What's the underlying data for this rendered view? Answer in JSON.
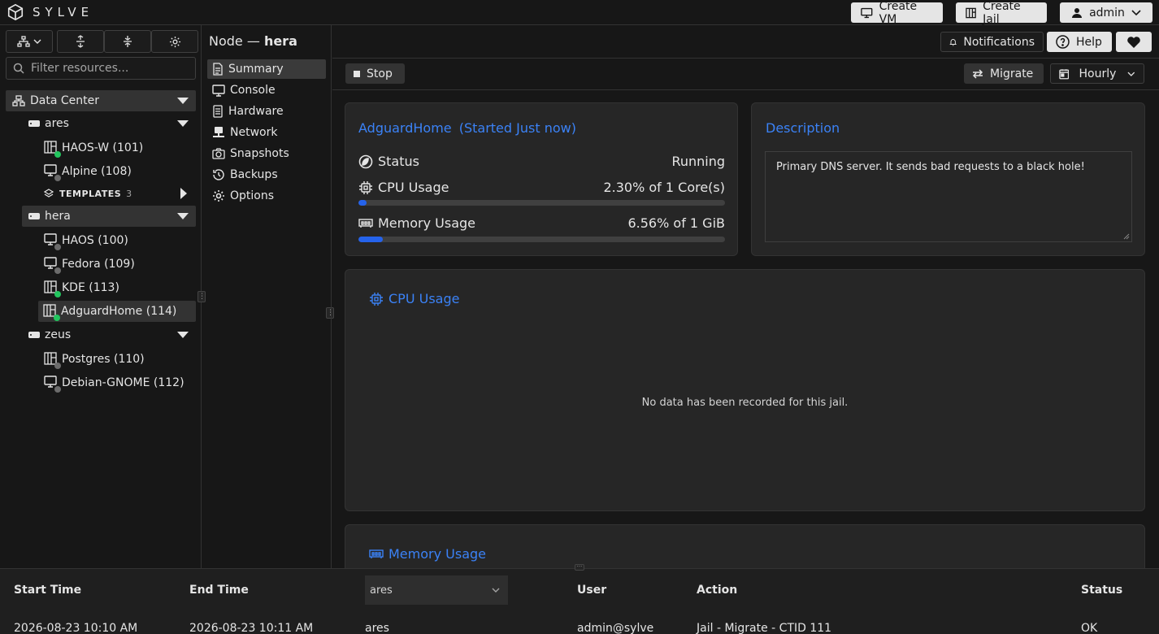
{
  "app": {
    "name": "SYLVE"
  },
  "topbar": {
    "create_vm": "Create VM",
    "create_jail": "Create Jail",
    "user": "admin"
  },
  "sidebar": {
    "filter_placeholder": "Filter resources...",
    "datacenter": "Data Center",
    "nodes": [
      {
        "name": "ares",
        "items": [
          {
            "label": "HAOS-W (101)",
            "type": "jail",
            "running": true
          },
          {
            "label": "Alpine (108)",
            "type": "vm",
            "running": false
          }
        ],
        "templates_label": "TEMPLATES",
        "templates_count": "3"
      },
      {
        "name": "hera",
        "items": [
          {
            "label": "HAOS (100)",
            "type": "vm",
            "running": false
          },
          {
            "label": "Fedora (109)",
            "type": "vm",
            "running": false
          },
          {
            "label": "KDE (113)",
            "type": "jail",
            "running": true
          },
          {
            "label": "AdguardHome (114)",
            "type": "jail",
            "running": true
          }
        ]
      },
      {
        "name": "zeus",
        "items": [
          {
            "label": "Postgres (110)",
            "type": "jail",
            "running": false
          },
          {
            "label": "Debian-GNOME (112)",
            "type": "vm",
            "running": false
          }
        ]
      }
    ]
  },
  "header": {
    "node_prefix": "Node —",
    "node_name": "hera",
    "notifications": "Notifications",
    "help": "Help"
  },
  "nav": {
    "summary": "Summary",
    "console": "Console",
    "hardware": "Hardware",
    "network": "Network",
    "snapshots": "Snapshots",
    "backups": "Backups",
    "options": "Options"
  },
  "actions": {
    "stop": "Stop",
    "migrate": "Migrate",
    "interval": "Hourly"
  },
  "summary": {
    "name": "AdguardHome",
    "started": "(Started Just now)",
    "status_label": "Status",
    "status_value": "Running",
    "cpu_label": "CPU Usage",
    "cpu_value": "2.30% of 1 Core(s)",
    "cpu_percent": 2.3,
    "mem_label": "Memory Usage",
    "mem_value": "6.56% of 1 GiB",
    "mem_percent": 6.56
  },
  "description": {
    "title": "Description",
    "text": "Primary DNS server. It sends bad requests to a black hole!"
  },
  "cpu_chart": {
    "title": "CPU Usage",
    "empty": "No data has been recorded for this jail."
  },
  "mem_chart": {
    "title": "Memory Usage"
  },
  "log_table": {
    "headers": {
      "start": "Start Time",
      "end": "End Time",
      "user": "User",
      "action": "Action",
      "status": "Status"
    },
    "node_filter": "ares",
    "rows": [
      {
        "start": "2026-08-23 10:10 AM",
        "end": "2026-08-23 10:11 AM",
        "node": "ares",
        "user": "admin@sylve",
        "action": "Jail - Migrate - CTID 111",
        "status": "OK"
      }
    ]
  },
  "colors": {
    "accent": "#3b82f6",
    "running": "#22c55e",
    "stopped": "#6b6b6b"
  }
}
